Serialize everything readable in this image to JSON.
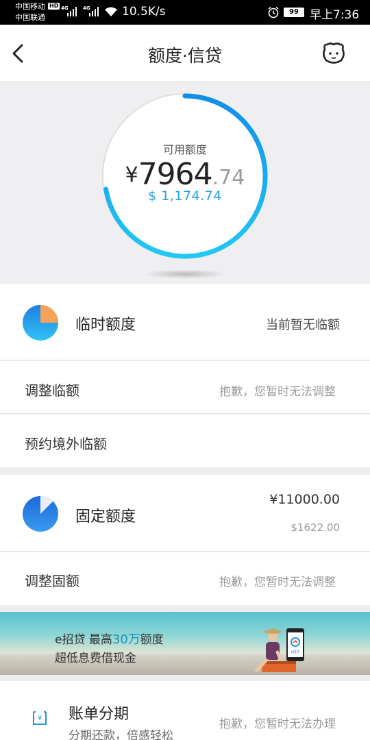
{
  "status_bar": {
    "carrier1": "中国移动",
    "carrier2": "中国联通",
    "hd": "HD",
    "net1": "4G",
    "net2": "4G",
    "speed": "10.5K/s",
    "battery": "99",
    "time": "早上7:36"
  },
  "nav": {
    "title": "额度·信贷",
    "back_icon": "chevron-left-icon",
    "right_icon": "mascot-icon"
  },
  "credit": {
    "label": "可用额度",
    "currency": "¥",
    "amount_int": "7964",
    "amount_dec": ".74",
    "usd": "$ 1,174.74",
    "ring_fraction": 0.724,
    "ring_color_start": "#0f8fe8",
    "ring_color_end": "#22c8f4"
  },
  "temporary": {
    "title": "临时额度",
    "status": "当前暂无临额",
    "pie_fraction": 0.25,
    "actions": [
      {
        "label": "调整临额",
        "note": "抱歉，您暂时无法调整"
      },
      {
        "label": "预约境外临额",
        "note": ""
      }
    ]
  },
  "fixed": {
    "title": "固定额度",
    "amount_cny": "¥11000.00",
    "amount_usd": "$1622.00",
    "pie_fraction": 0.125,
    "actions": [
      {
        "label": "调整固额",
        "note": "抱歉，您暂时无法调整"
      }
    ]
  },
  "banner": {
    "line1_prefix": "e招贷  最高",
    "line1_highlight": "30万",
    "line1_suffix": "额度",
    "line2": "超低息费借现金",
    "phone_label": "e招贷"
  },
  "installment": {
    "title": "账单分期",
    "subtitle": "分期还款，倍感轻松",
    "note": "抱歉，您暂时无法办理",
    "icon": "yen-bill-icon",
    "icon_glyph": "¥"
  },
  "colors": {
    "accent_blue": "#1e90e6",
    "usd_blue": "#27a0e2",
    "pie_orange": "#f5a25a"
  }
}
